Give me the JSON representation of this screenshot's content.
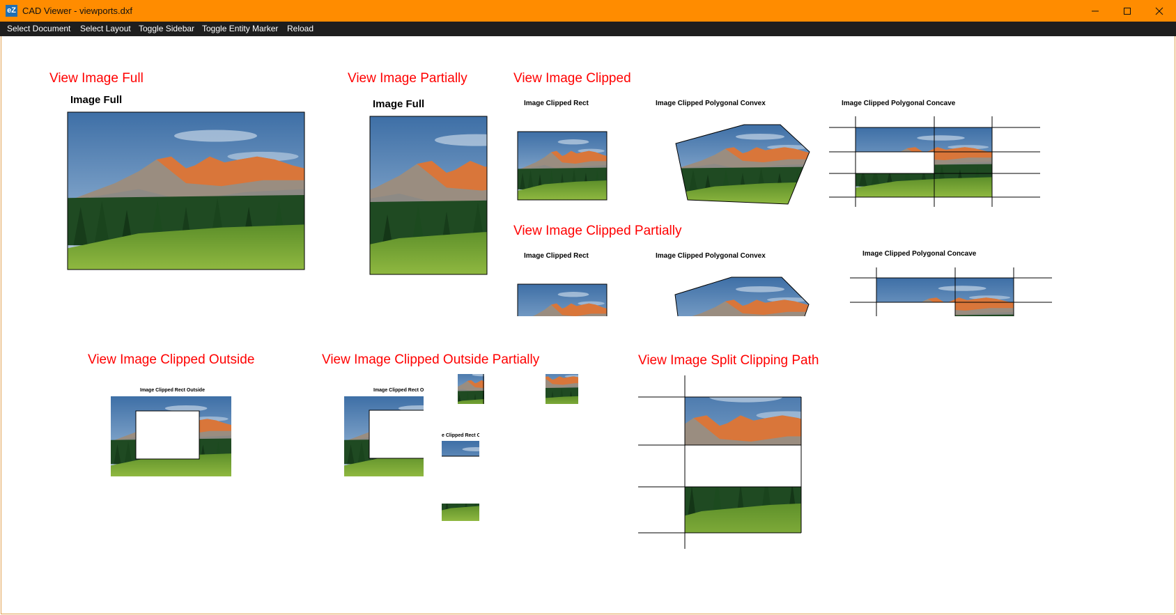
{
  "window": {
    "title": "CAD Viewer - viewports.dxf",
    "icon": "ez-app-icon",
    "icon_text": "eZ"
  },
  "window_controls": {
    "minimize_icon": "minimize-icon",
    "maximize_icon": "maximize-icon",
    "close_icon": "close-icon"
  },
  "menu": {
    "items": [
      {
        "label": "Select Document"
      },
      {
        "label": "Select Layout"
      },
      {
        "label": "Toggle Sidebar"
      },
      {
        "label": "Toggle Entity Marker"
      },
      {
        "label": "Reload"
      }
    ]
  },
  "viewports": {
    "full": {
      "heading": "View Image Full",
      "caption": "Image Full"
    },
    "partial": {
      "heading": "View Image Partially",
      "caption": "Image Full"
    },
    "clipped": {
      "heading": "View Image Clipped",
      "rect": "Image Clipped Rect",
      "convex": "Image Clipped Polygonal Convex",
      "concave": "Image Clipped Polygonal Concave"
    },
    "clipped_partial": {
      "heading": "View Image Clipped Partially",
      "rect": "Image Clipped Rect",
      "convex": "Image Clipped Polygonal Convex",
      "concave": "Image Clipped Polygonal Concave"
    },
    "clipped_outside": {
      "heading": "View Image Clipped Outside",
      "caption": "Image Clipped Rect Outside"
    },
    "clipped_outside_partial": {
      "heading": "View Image Clipped Outside Partially",
      "caption": "Image Clipped Rect Ou",
      "caption_small": "e Clipped Rect Ou"
    },
    "split": {
      "heading": "View Image Split Clipping Path"
    }
  },
  "colors": {
    "titlebar": "#ff8c00",
    "menubar": "#1e1e1e",
    "heading": "#ff0000",
    "canvas": "#ffffff"
  }
}
